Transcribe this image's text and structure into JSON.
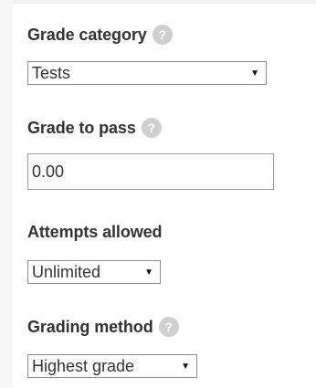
{
  "grade_category": {
    "label": "Grade category",
    "help_icon": "?",
    "selected": "Tests"
  },
  "grade_to_pass": {
    "label": "Grade to pass",
    "help_icon": "?",
    "value": "0.00"
  },
  "attempts_allowed": {
    "label": "Attempts allowed",
    "selected": "Unlimited"
  },
  "grading_method": {
    "label": "Grading method",
    "help_icon": "?",
    "selected": "Highest grade"
  },
  "dropdown_arrow": "▼",
  "colors": {
    "help_icon_bg": "#cfcfcf",
    "label_text": "#333333",
    "border": "#8e8e8e"
  }
}
